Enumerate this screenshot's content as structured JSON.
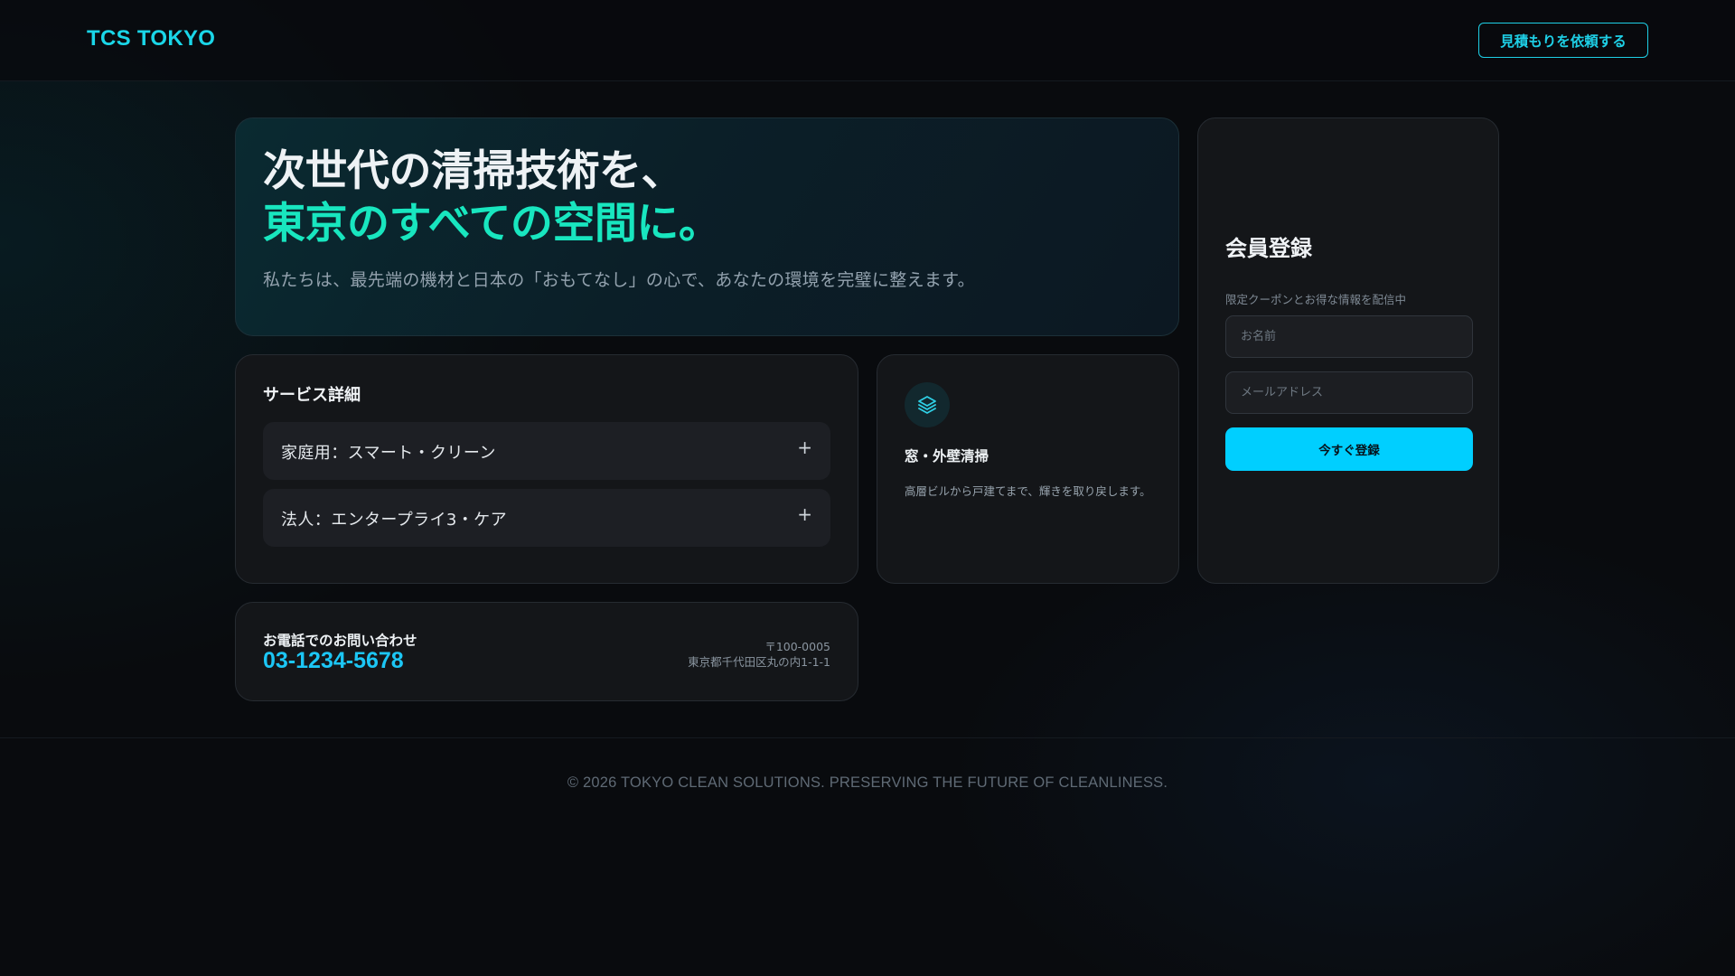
{
  "header": {
    "logo": "TCS TOKYO",
    "cta_label": "見積もりを依頼する"
  },
  "hero": {
    "title_line1": "次世代の清掃技術を、",
    "title_line2": "東京のすべての空間に。",
    "subtitle": "私たちは、最先端の機材と日本の「おもてなし」の心で、あなたの環境を完璧に整えます。"
  },
  "services": {
    "heading": "サービス詳細",
    "items": [
      {
        "label": "家庭用：スマート・クリーン",
        "toggle": "+"
      },
      {
        "label": "法人：エンタープライ3・ケア",
        "toggle": "+"
      }
    ]
  },
  "feature": {
    "icon": "layers-icon",
    "title": "窓・外壁清掃",
    "description": "高層ビルから戸建てまで、輝きを取り戻します。"
  },
  "signup": {
    "title": "会員登録",
    "note": "限定クーポンとお得な情報を配信中",
    "name_placeholder": "お名前",
    "email_placeholder": "メールアドレス",
    "submit_label": "今すぐ登録"
  },
  "contact": {
    "label": "お電話でのお問い合わせ",
    "phone": "03-1234-5678",
    "postal": "〒100-0005",
    "address": "東京都千代田区丸の内1-1-1"
  },
  "footer": {
    "copyright": "© 2026 TOKYO CLEAN SOLUTIONS. PRESERVING THE FUTURE OF CLEANLINESS."
  },
  "colors": {
    "accent_cyan": "#00cfff",
    "accent_green": "#18e6bf",
    "background": "#090b0e",
    "card": "#141619"
  }
}
